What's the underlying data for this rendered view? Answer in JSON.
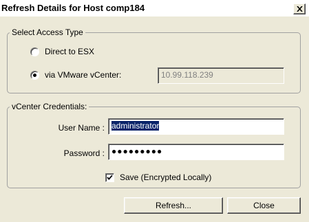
{
  "window": {
    "title": "Refresh Details for Host comp184"
  },
  "access_type": {
    "legend": "Select Access Type",
    "options": [
      {
        "label": "Direct to ESX",
        "selected": false
      },
      {
        "label": "via VMware vCenter:",
        "selected": true
      }
    ],
    "vcenter_address": "10.99.118.239"
  },
  "credentials": {
    "legend": "vCenter Credentials:",
    "username_label": "User Name :",
    "username_value": "administrator",
    "password_label": "Password :",
    "password_value": "●●●●●●●●●",
    "save_label": "Save (Encrypted Locally)",
    "save_checked": true
  },
  "buttons": {
    "refresh": "Refresh...",
    "close": "Close"
  }
}
